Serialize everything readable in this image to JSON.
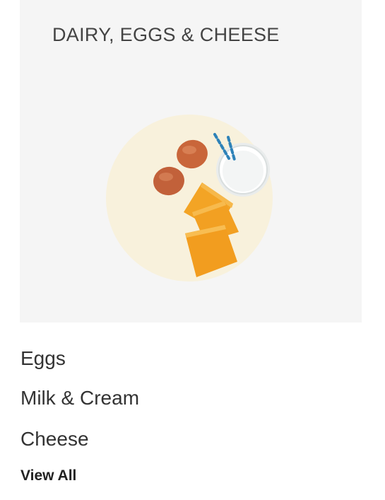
{
  "category": {
    "title": "DAIRY, EGGS & CHEESE",
    "image_icon": "dairy-eggs-cheese-illustration",
    "background_color": "#f5f5f5",
    "plate_color": "#f8f1dc"
  },
  "subcategories": [
    {
      "label": "Eggs"
    },
    {
      "label": "Milk & Cream"
    },
    {
      "label": "Cheese"
    }
  ],
  "view_all_label": "View All"
}
